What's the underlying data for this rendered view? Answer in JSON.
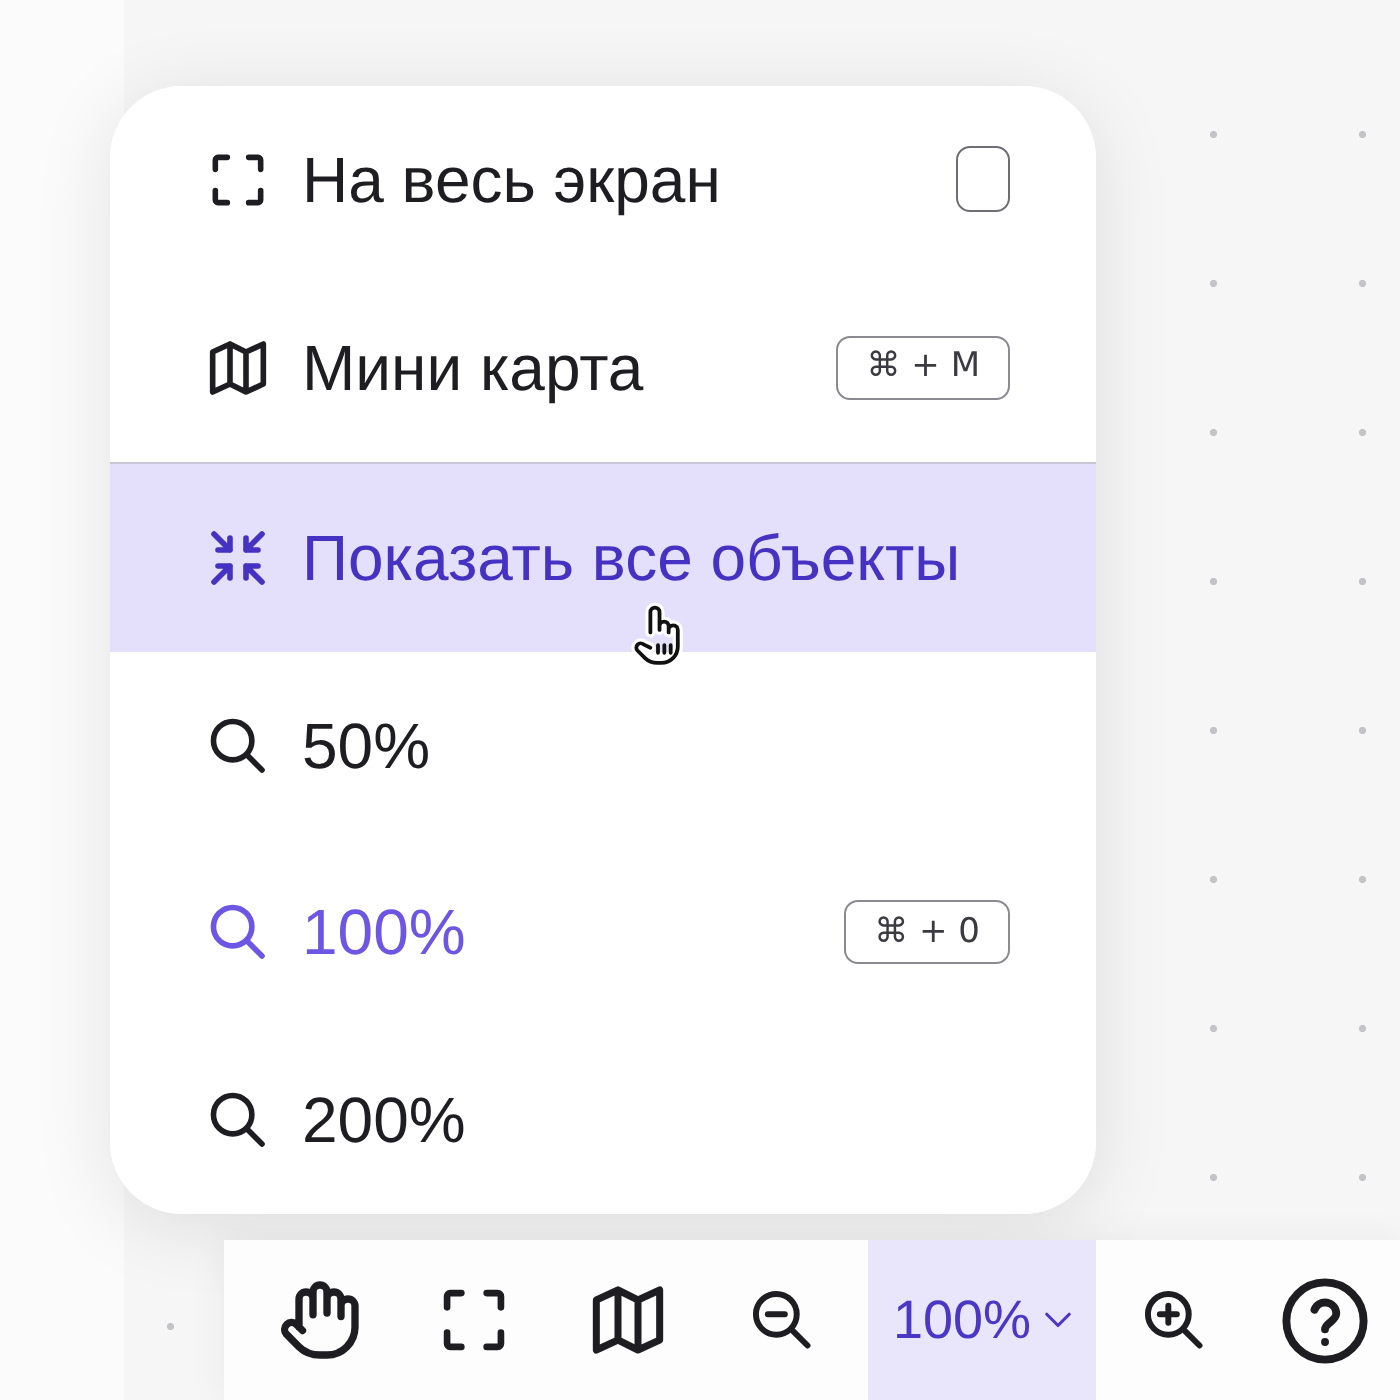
{
  "menu": {
    "sections": [
      {
        "items": [
          {
            "kind": "fullscreen",
            "label": "На весь экран",
            "checked": false,
            "hovered": false,
            "selected": false
          },
          {
            "kind": "minimap",
            "label": "Мини карта",
            "shortcut": "⌘ + M",
            "hovered": false,
            "selected": false
          }
        ]
      },
      {
        "items": [
          {
            "kind": "fit",
            "label": "Показать все объекты",
            "hovered": true,
            "selected": false
          },
          {
            "kind": "zoom",
            "label": "50%",
            "hovered": false,
            "selected": false
          },
          {
            "kind": "zoom",
            "label": "100%",
            "shortcut": "⌘ + 0",
            "hovered": false,
            "selected": true
          },
          {
            "kind": "zoom",
            "label": "200%",
            "hovered": false,
            "selected": false
          }
        ]
      }
    ]
  },
  "toolbar": {
    "items": [
      {
        "kind": "hand"
      },
      {
        "kind": "fullscreen"
      },
      {
        "kind": "minimap"
      },
      {
        "kind": "zoom_out"
      },
      {
        "kind": "zoom_menu",
        "label": "100%",
        "expanded": true
      },
      {
        "kind": "zoom_in"
      },
      {
        "kind": "help"
      }
    ]
  }
}
